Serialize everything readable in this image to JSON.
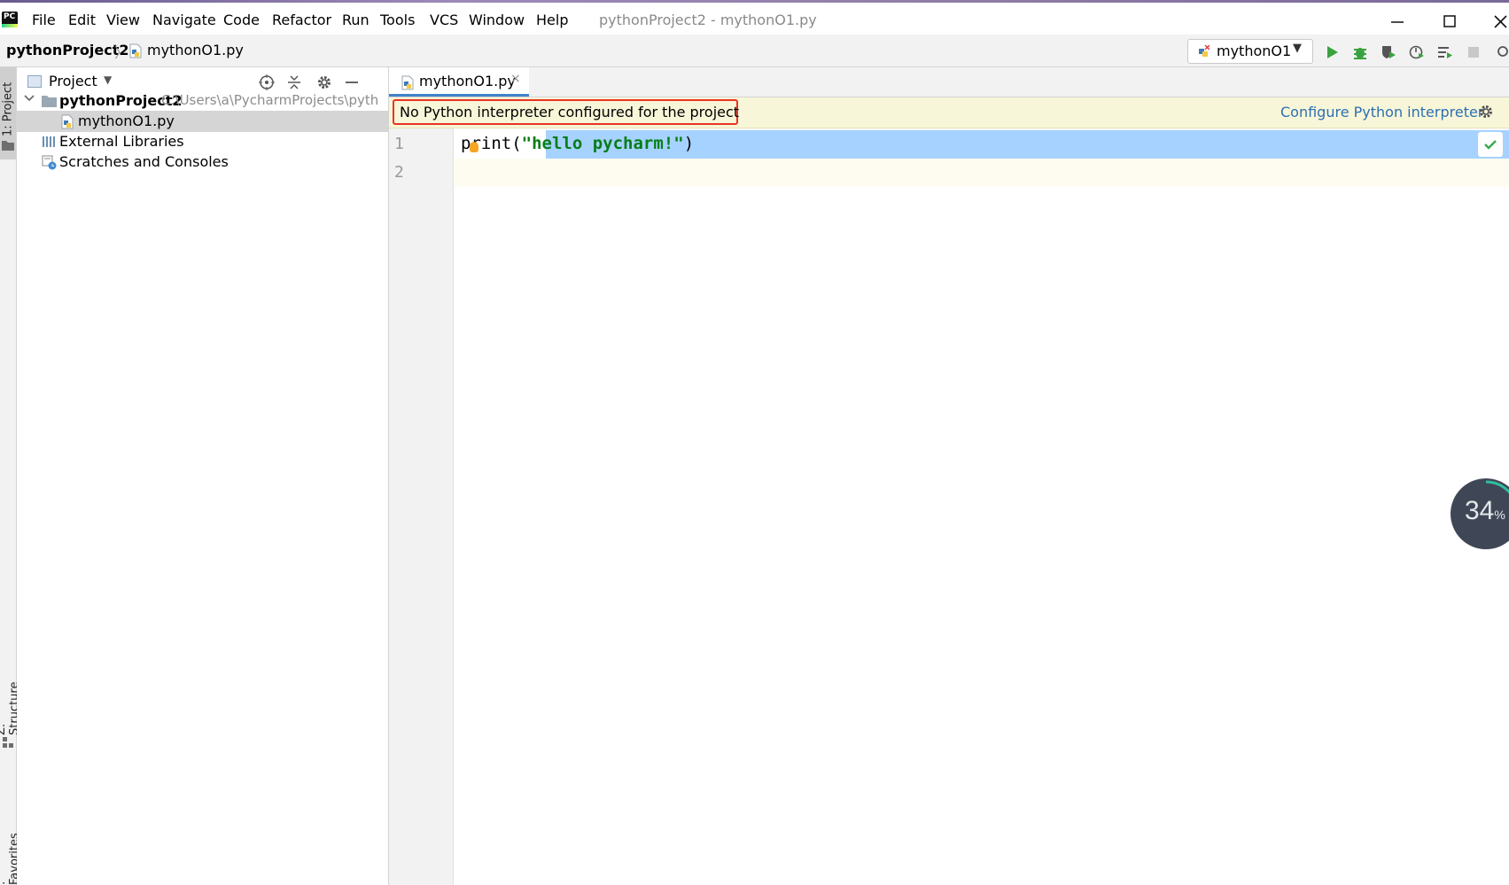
{
  "menubar": {
    "logo": "PC",
    "items": [
      "File",
      "Edit",
      "View",
      "Navigate",
      "Code",
      "Refactor",
      "Run",
      "Tools",
      "VCS",
      "Window",
      "Help"
    ],
    "title": "pythonProject2 - mythonO1.py"
  },
  "navbar": {
    "project": "pythonProject2",
    "separator": "〉",
    "file": "mythonO1.py",
    "run_config": "mythonO1"
  },
  "left_stripe": {
    "project": "1: Project",
    "structure": "Z: Structure",
    "favorites": ": Favorites"
  },
  "project_panel": {
    "header": "Project",
    "tree": [
      {
        "label": "pythonProject2",
        "detail": "C:\\Users\\a\\PycharmProjects\\pyth"
      },
      {
        "label": "mythonO1.py"
      },
      {
        "label": "External Libraries"
      },
      {
        "label": "Scratches and Consoles"
      }
    ]
  },
  "editor": {
    "tab_label": "mythonO1.py",
    "tab_close": "×",
    "banner_message": "No Python interpreter configured for the project",
    "banner_link": "Configure Python interpreter",
    "line_numbers": [
      "1",
      "2"
    ],
    "code": {
      "p": "p",
      "rint": "rint(",
      "string": "\"hello pycharm!\"",
      "close": ")"
    }
  },
  "progress": {
    "value": "34",
    "unit": "%",
    "fraction": 0.34
  },
  "colors": {
    "accent": "#4083c9",
    "selection": "#a6d2ff",
    "banner": "#f8f6d8",
    "error_box": "#ea3323",
    "link": "#2c6fb3",
    "string": "#067d17"
  }
}
